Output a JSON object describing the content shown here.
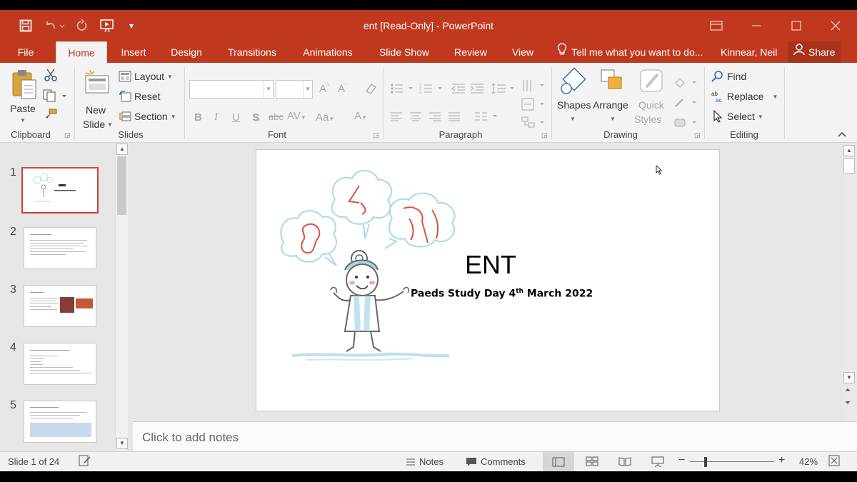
{
  "window": {
    "title": "ent [Read-Only] - PowerPoint"
  },
  "tabs": [
    "File",
    "Home",
    "Insert",
    "Design",
    "Transitions",
    "Animations",
    "Slide Show",
    "Review",
    "View"
  ],
  "active_tab": "Home",
  "tell_me": "Tell me what you want to do...",
  "user": "Kinnear, Neil",
  "share_label": "Share",
  "ribbon": {
    "clipboard": {
      "label": "Clipboard",
      "paste": "Paste"
    },
    "slides": {
      "label": "Slides",
      "new_slide_line1": "New",
      "new_slide_line2": "Slide",
      "layout": "Layout",
      "reset": "Reset",
      "section": "Section"
    },
    "font": {
      "label": "Font"
    },
    "paragraph": {
      "label": "Paragraph"
    },
    "drawing": {
      "label": "Drawing",
      "shapes": "Shapes",
      "arrange": "Arrange",
      "quick_line1": "Quick",
      "quick_line2": "Styles"
    },
    "editing": {
      "label": "Editing",
      "find": "Find",
      "replace": "Replace",
      "select": "Select"
    }
  },
  "thumbnails": [
    {
      "num": "1"
    },
    {
      "num": "2"
    },
    {
      "num": "3"
    },
    {
      "num": "4"
    },
    {
      "num": "5"
    }
  ],
  "slide": {
    "title": "ENT",
    "subtitle_pre": "Paeds Study Day 4",
    "subtitle_sup": "th",
    "subtitle_post": " March 2022"
  },
  "notes_placeholder": "Click to add notes",
  "status": {
    "slide_counter": "Slide 1 of 24",
    "notes": "Notes",
    "comments": "Comments",
    "zoom": "42%"
  },
  "colors": {
    "accent": "#c0391e",
    "ribbon": "#f3f3f3"
  }
}
